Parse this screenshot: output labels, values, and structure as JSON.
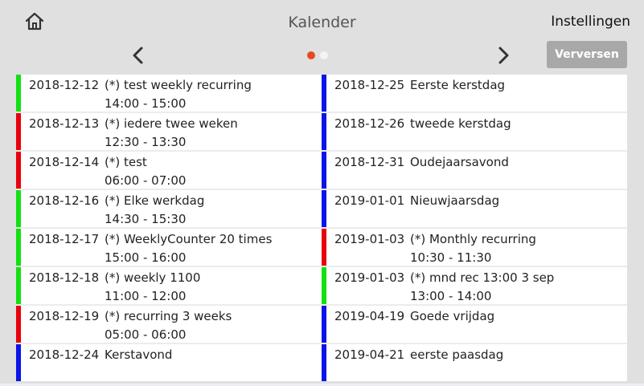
{
  "header": {
    "title": "Kalender",
    "settings_label": "Instellingen",
    "refresh_label": "Verversen",
    "home_icon": "home-icon",
    "prev_icon": "chevron-left-icon",
    "next_icon": "chevron-right-icon",
    "page_indicator": {
      "count": 2,
      "active": 1
    }
  },
  "colors": {
    "green": "#12e012",
    "red": "#e8000c",
    "blue": "#0a14e8",
    "active_dot": "#e8491d"
  },
  "events": {
    "left": [
      {
        "date": "2018-12-12",
        "name": "(*) test weekly recurring",
        "time": "14:00 - 15:00",
        "color": "green"
      },
      {
        "date": "2018-12-13",
        "name": "(*) iedere twee weken",
        "time": "12:30 - 13:30",
        "color": "red"
      },
      {
        "date": "2018-12-14",
        "name": "(*) test",
        "time": "06:00 - 07:00",
        "color": "red"
      },
      {
        "date": "2018-12-16",
        "name": "(*) Elke werkdag",
        "time": "14:30 - 15:30",
        "color": "green"
      },
      {
        "date": "2018-12-17",
        "name": "(*) WeeklyCounter 20 times",
        "time": "15:00 - 16:00",
        "color": "green"
      },
      {
        "date": "2018-12-18",
        "name": "(*) weekly 1100",
        "time": "11:00 - 12:00",
        "color": "green"
      },
      {
        "date": "2018-12-19",
        "name": "(*) recurring 3 weeks",
        "time": "05:00 - 06:00",
        "color": "red"
      },
      {
        "date": "2018-12-24",
        "name": "Kerstavond",
        "time": "",
        "color": "blue"
      }
    ],
    "right": [
      {
        "date": "2018-12-25",
        "name": "Eerste kerstdag",
        "time": "",
        "color": "blue"
      },
      {
        "date": "2018-12-26",
        "name": "tweede kerstdag",
        "time": "",
        "color": "blue"
      },
      {
        "date": "2018-12-31",
        "name": "Oudejaarsavond",
        "time": "",
        "color": "blue"
      },
      {
        "date": "2019-01-01",
        "name": "Nieuwjaarsdag",
        "time": "",
        "color": "blue"
      },
      {
        "date": "2019-01-03",
        "name": "(*) Monthly recurring",
        "time": "10:30 - 11:30",
        "color": "red"
      },
      {
        "date": "2019-01-03",
        "name": "(*) mnd rec 13:00 3 sep",
        "time": "13:00 - 14:00",
        "color": "green"
      },
      {
        "date": "2019-04-19",
        "name": "Goede vrijdag",
        "time": "",
        "color": "blue"
      },
      {
        "date": "2019-04-21",
        "name": "eerste paasdag",
        "time": "",
        "color": "blue"
      }
    ]
  }
}
